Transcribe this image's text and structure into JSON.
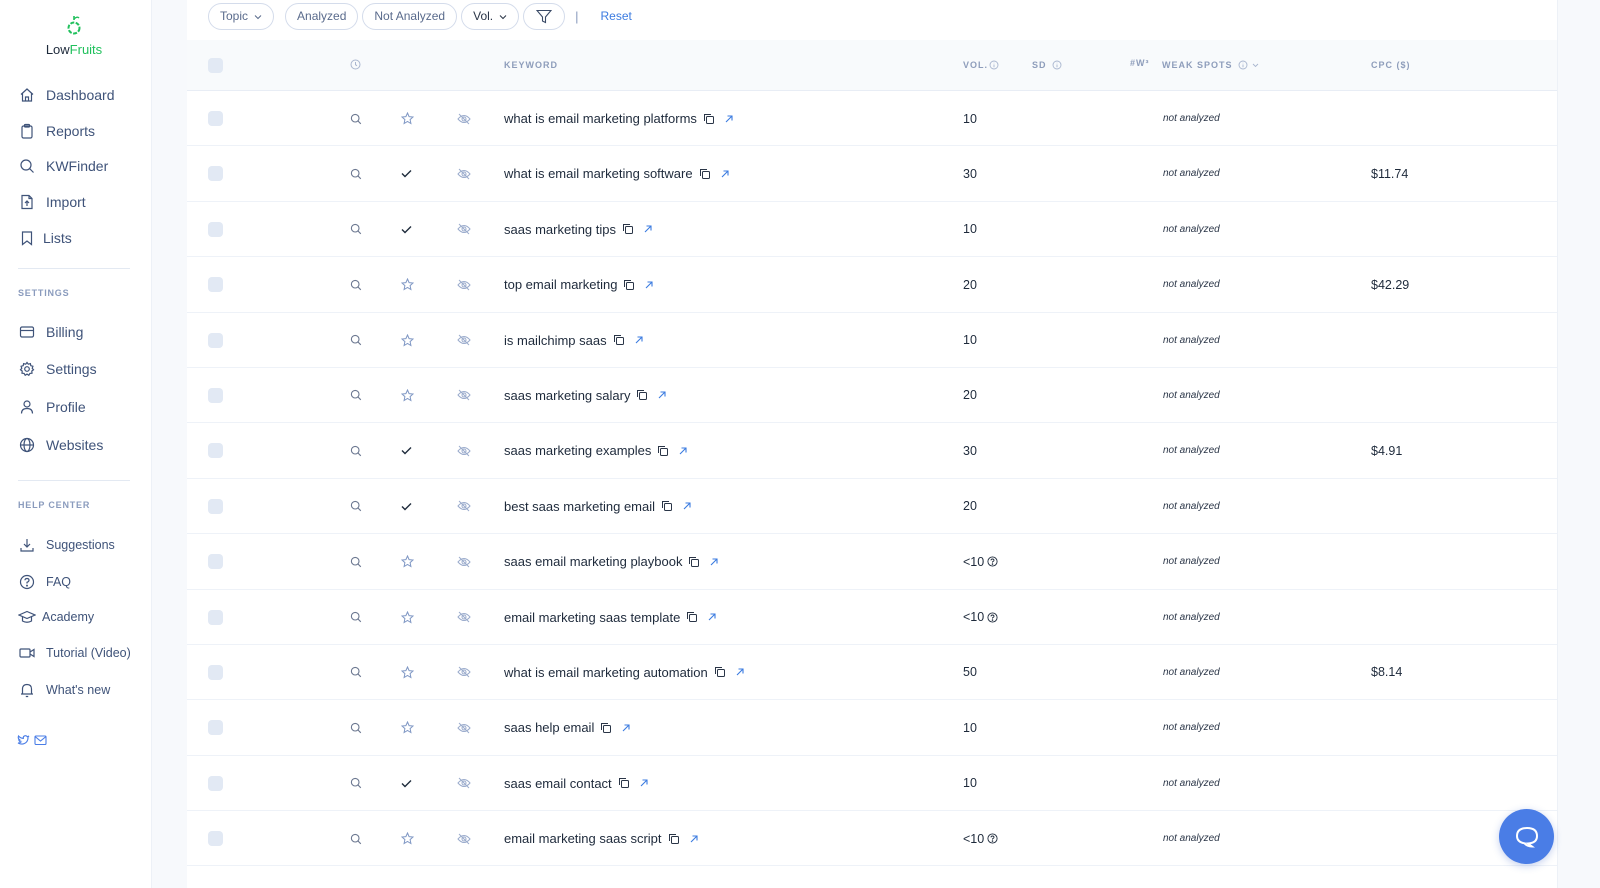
{
  "app": {
    "logo_part1": "Low",
    "logo_part2": "Fruits"
  },
  "sidebar": {
    "main_items": [
      {
        "label": "Dashboard",
        "icon": "home-icon"
      },
      {
        "label": "Reports",
        "icon": "clipboard-icon"
      },
      {
        "label": "KWFinder",
        "icon": "search-icon"
      },
      {
        "label": "Import",
        "icon": "file-upload-icon"
      },
      {
        "label": "Lists",
        "icon": "bookmark-icon"
      }
    ],
    "settings_label": "SETTINGS",
    "settings_items": [
      {
        "label": "Billing",
        "icon": "credit-card-icon"
      },
      {
        "label": "Settings",
        "icon": "gear-icon"
      },
      {
        "label": "Profile",
        "icon": "user-icon"
      },
      {
        "label": "Websites",
        "icon": "globe-icon"
      }
    ],
    "help_label": "HELP CENTER",
    "help_items": [
      {
        "label": "Suggestions",
        "icon": "download-icon"
      },
      {
        "label": "FAQ",
        "icon": "question-circle-icon"
      },
      {
        "label": "Academy",
        "icon": "graduation-cap-icon"
      },
      {
        "label": "Tutorial (Video)",
        "icon": "video-icon"
      },
      {
        "label": "What's new",
        "icon": "bell-icon"
      }
    ],
    "social": [
      "twitter-icon",
      "mail-icon"
    ]
  },
  "filters": {
    "topic": "Topic",
    "analyzed": "Analyzed",
    "not_analyzed": "Not Analyzed",
    "vol": "Vol.",
    "separator": "|",
    "reset": "Reset"
  },
  "table": {
    "headers": {
      "keyword": "KEYWORD",
      "vol": "VOL.",
      "sd": "SD",
      "w3": "#W³",
      "weak_spots": "WEAK SPOTS",
      "cpc": "CPC ($)"
    },
    "rows": [
      {
        "keyword": "what is email marketing platforms",
        "starred": false,
        "vol": "10",
        "vol_help": false,
        "weak": "not analyzed",
        "cpc": ""
      },
      {
        "keyword": "what is email marketing software",
        "starred": true,
        "vol": "30",
        "vol_help": false,
        "weak": "not analyzed",
        "cpc": "$11.74"
      },
      {
        "keyword": "saas marketing tips",
        "starred": true,
        "vol": "10",
        "vol_help": false,
        "weak": "not analyzed",
        "cpc": ""
      },
      {
        "keyword": "top email marketing",
        "starred": false,
        "vol": "20",
        "vol_help": false,
        "weak": "not analyzed",
        "cpc": "$42.29"
      },
      {
        "keyword": "is mailchimp saas",
        "starred": false,
        "vol": "10",
        "vol_help": false,
        "weak": "not analyzed",
        "cpc": ""
      },
      {
        "keyword": "saas marketing salary",
        "starred": false,
        "vol": "20",
        "vol_help": false,
        "weak": "not analyzed",
        "cpc": ""
      },
      {
        "keyword": "saas marketing examples",
        "starred": true,
        "vol": "30",
        "vol_help": false,
        "weak": "not analyzed",
        "cpc": "$4.91"
      },
      {
        "keyword": "best saas marketing email",
        "starred": true,
        "vol": "20",
        "vol_help": false,
        "weak": "not analyzed",
        "cpc": ""
      },
      {
        "keyword": "saas email marketing playbook",
        "starred": false,
        "vol": "<10",
        "vol_help": true,
        "weak": "not analyzed",
        "cpc": ""
      },
      {
        "keyword": "email marketing saas template",
        "starred": false,
        "vol": "<10",
        "vol_help": true,
        "weak": "not analyzed",
        "cpc": ""
      },
      {
        "keyword": "what is email marketing automation",
        "starred": false,
        "vol": "50",
        "vol_help": false,
        "weak": "not analyzed",
        "cpc": "$8.14"
      },
      {
        "keyword": "saas help email",
        "starred": false,
        "vol": "10",
        "vol_help": false,
        "weak": "not analyzed",
        "cpc": ""
      },
      {
        "keyword": "saas email contact",
        "starred": true,
        "vol": "10",
        "vol_help": false,
        "weak": "not analyzed",
        "cpc": ""
      },
      {
        "keyword": "email marketing saas script",
        "starred": false,
        "vol": "<10",
        "vol_help": true,
        "weak": "not analyzed",
        "cpc": ""
      }
    ]
  },
  "colors": {
    "brand_green": "#20c05c",
    "link_blue": "#3b7be0",
    "chat_blue": "#4a7de6"
  }
}
